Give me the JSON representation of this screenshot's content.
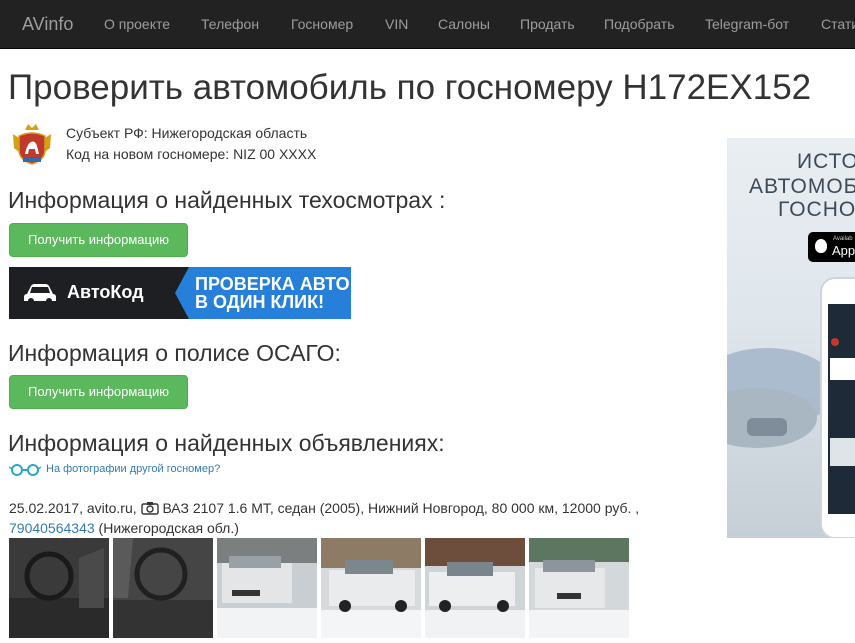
{
  "navbar": {
    "brand": "AVinfo",
    "items": [
      "О проекте",
      "Телефон",
      "Госномер",
      "VIN",
      "Салоны",
      "Продать",
      "Подобрать",
      "Telegram-бот",
      "Стати"
    ]
  },
  "page": {
    "title": "Проверить автомобиль по госномеру Н172ЕХ152",
    "region_subject": "Субъект РФ: Нижегородская область",
    "new_code": "Код на новом госномере: NIZ 00 XXXX"
  },
  "inspections": {
    "heading": "Информация о найденных техосмотрах :",
    "button": "Получить информацию"
  },
  "autokod_banner": {
    "brand": "АвтоКод",
    "slogan_line1": "ПРОВЕРКА АВТО",
    "slogan_line2": "В ОДИН КЛИК!"
  },
  "osago": {
    "heading": "Информация о полисе ОСАГО:",
    "button": "Получить информацию"
  },
  "ads_section": {
    "heading": "Информация о найденных объявлениях:",
    "other_plate_link": "На фотографии другой госномер?",
    "listing": {
      "date_source": "25.02.2017, avito.ru,",
      "details": "ВАЗ 2107 1.6 MT, седан (2005), Нижний Новгород, 80 000 км, 12000 руб. ,",
      "phone": "79040564343",
      "region": "(Нижегородская обл.)"
    }
  },
  "sidebar_ad": {
    "line1": "ИСТО",
    "line2": "АВТОМОБ",
    "line3": "ГОСНО",
    "store_small": "Availab",
    "store_big": "App"
  },
  "colors": {
    "navbar_bg": "#222222",
    "nav_text": "#9d9d9d",
    "button_green": "#5cb85c",
    "link_blue": "#337ab7",
    "autokod_blue": "#2680d9"
  }
}
